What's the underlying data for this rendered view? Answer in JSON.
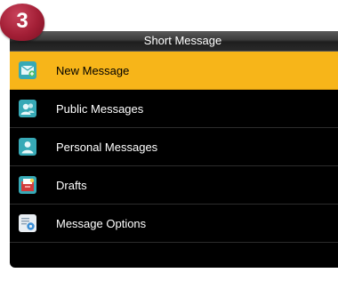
{
  "step_badge": "3",
  "header": {
    "title": "Short Message"
  },
  "menu": {
    "items": [
      {
        "label": "New Message",
        "icon": "new-message-icon",
        "selected": true
      },
      {
        "label": "Public Messages",
        "icon": "public-messages-icon",
        "selected": false
      },
      {
        "label": "Personal Messages",
        "icon": "personal-messages-icon",
        "selected": false
      },
      {
        "label": "Drafts",
        "icon": "drafts-icon",
        "selected": false
      },
      {
        "label": "Message Options",
        "icon": "message-options-icon",
        "selected": false
      }
    ]
  },
  "colors": {
    "selected_row": "#f7b519",
    "background": "#000000",
    "badge": "#a31f36"
  }
}
